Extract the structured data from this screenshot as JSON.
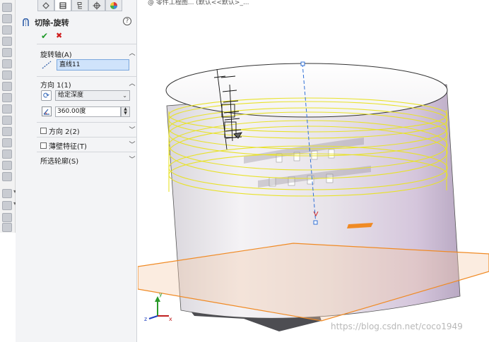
{
  "window": {
    "title_fragment": "@ 零件工程图... (默认<<默认>_...",
    "title_right": "· · · ·"
  },
  "property_manager": {
    "tabs": [
      "feature-manager-icon",
      "property-manager-icon",
      "configuration-icon",
      "dimxpert-icon",
      "display-manager-icon"
    ],
    "feature_title": "切除-旋转",
    "help_label": "?",
    "ok_label": "✔",
    "cancel_label": "✖",
    "axis_group": {
      "title": "旋转轴(A)",
      "value": "直线11"
    },
    "direction1": {
      "title": "方向 1(1)",
      "type": "给定深度",
      "angle": "360.00度"
    },
    "direction2": {
      "title": "方向 2(2)"
    },
    "thin_feature": {
      "title": "薄壁特征(T)"
    },
    "selected_contours": {
      "title": "所选轮廓(S)"
    }
  },
  "viewport": {
    "watermark": "https://blog.csdn.net/coco1949",
    "triad": {
      "x": "x",
      "y": "y",
      "z": "z"
    }
  },
  "colors": {
    "preview_yellow": "#e8e22a",
    "plane_orange": "#f08a24",
    "axis_blue": "#2f6fd6",
    "model_body": "#e9e6ee"
  }
}
